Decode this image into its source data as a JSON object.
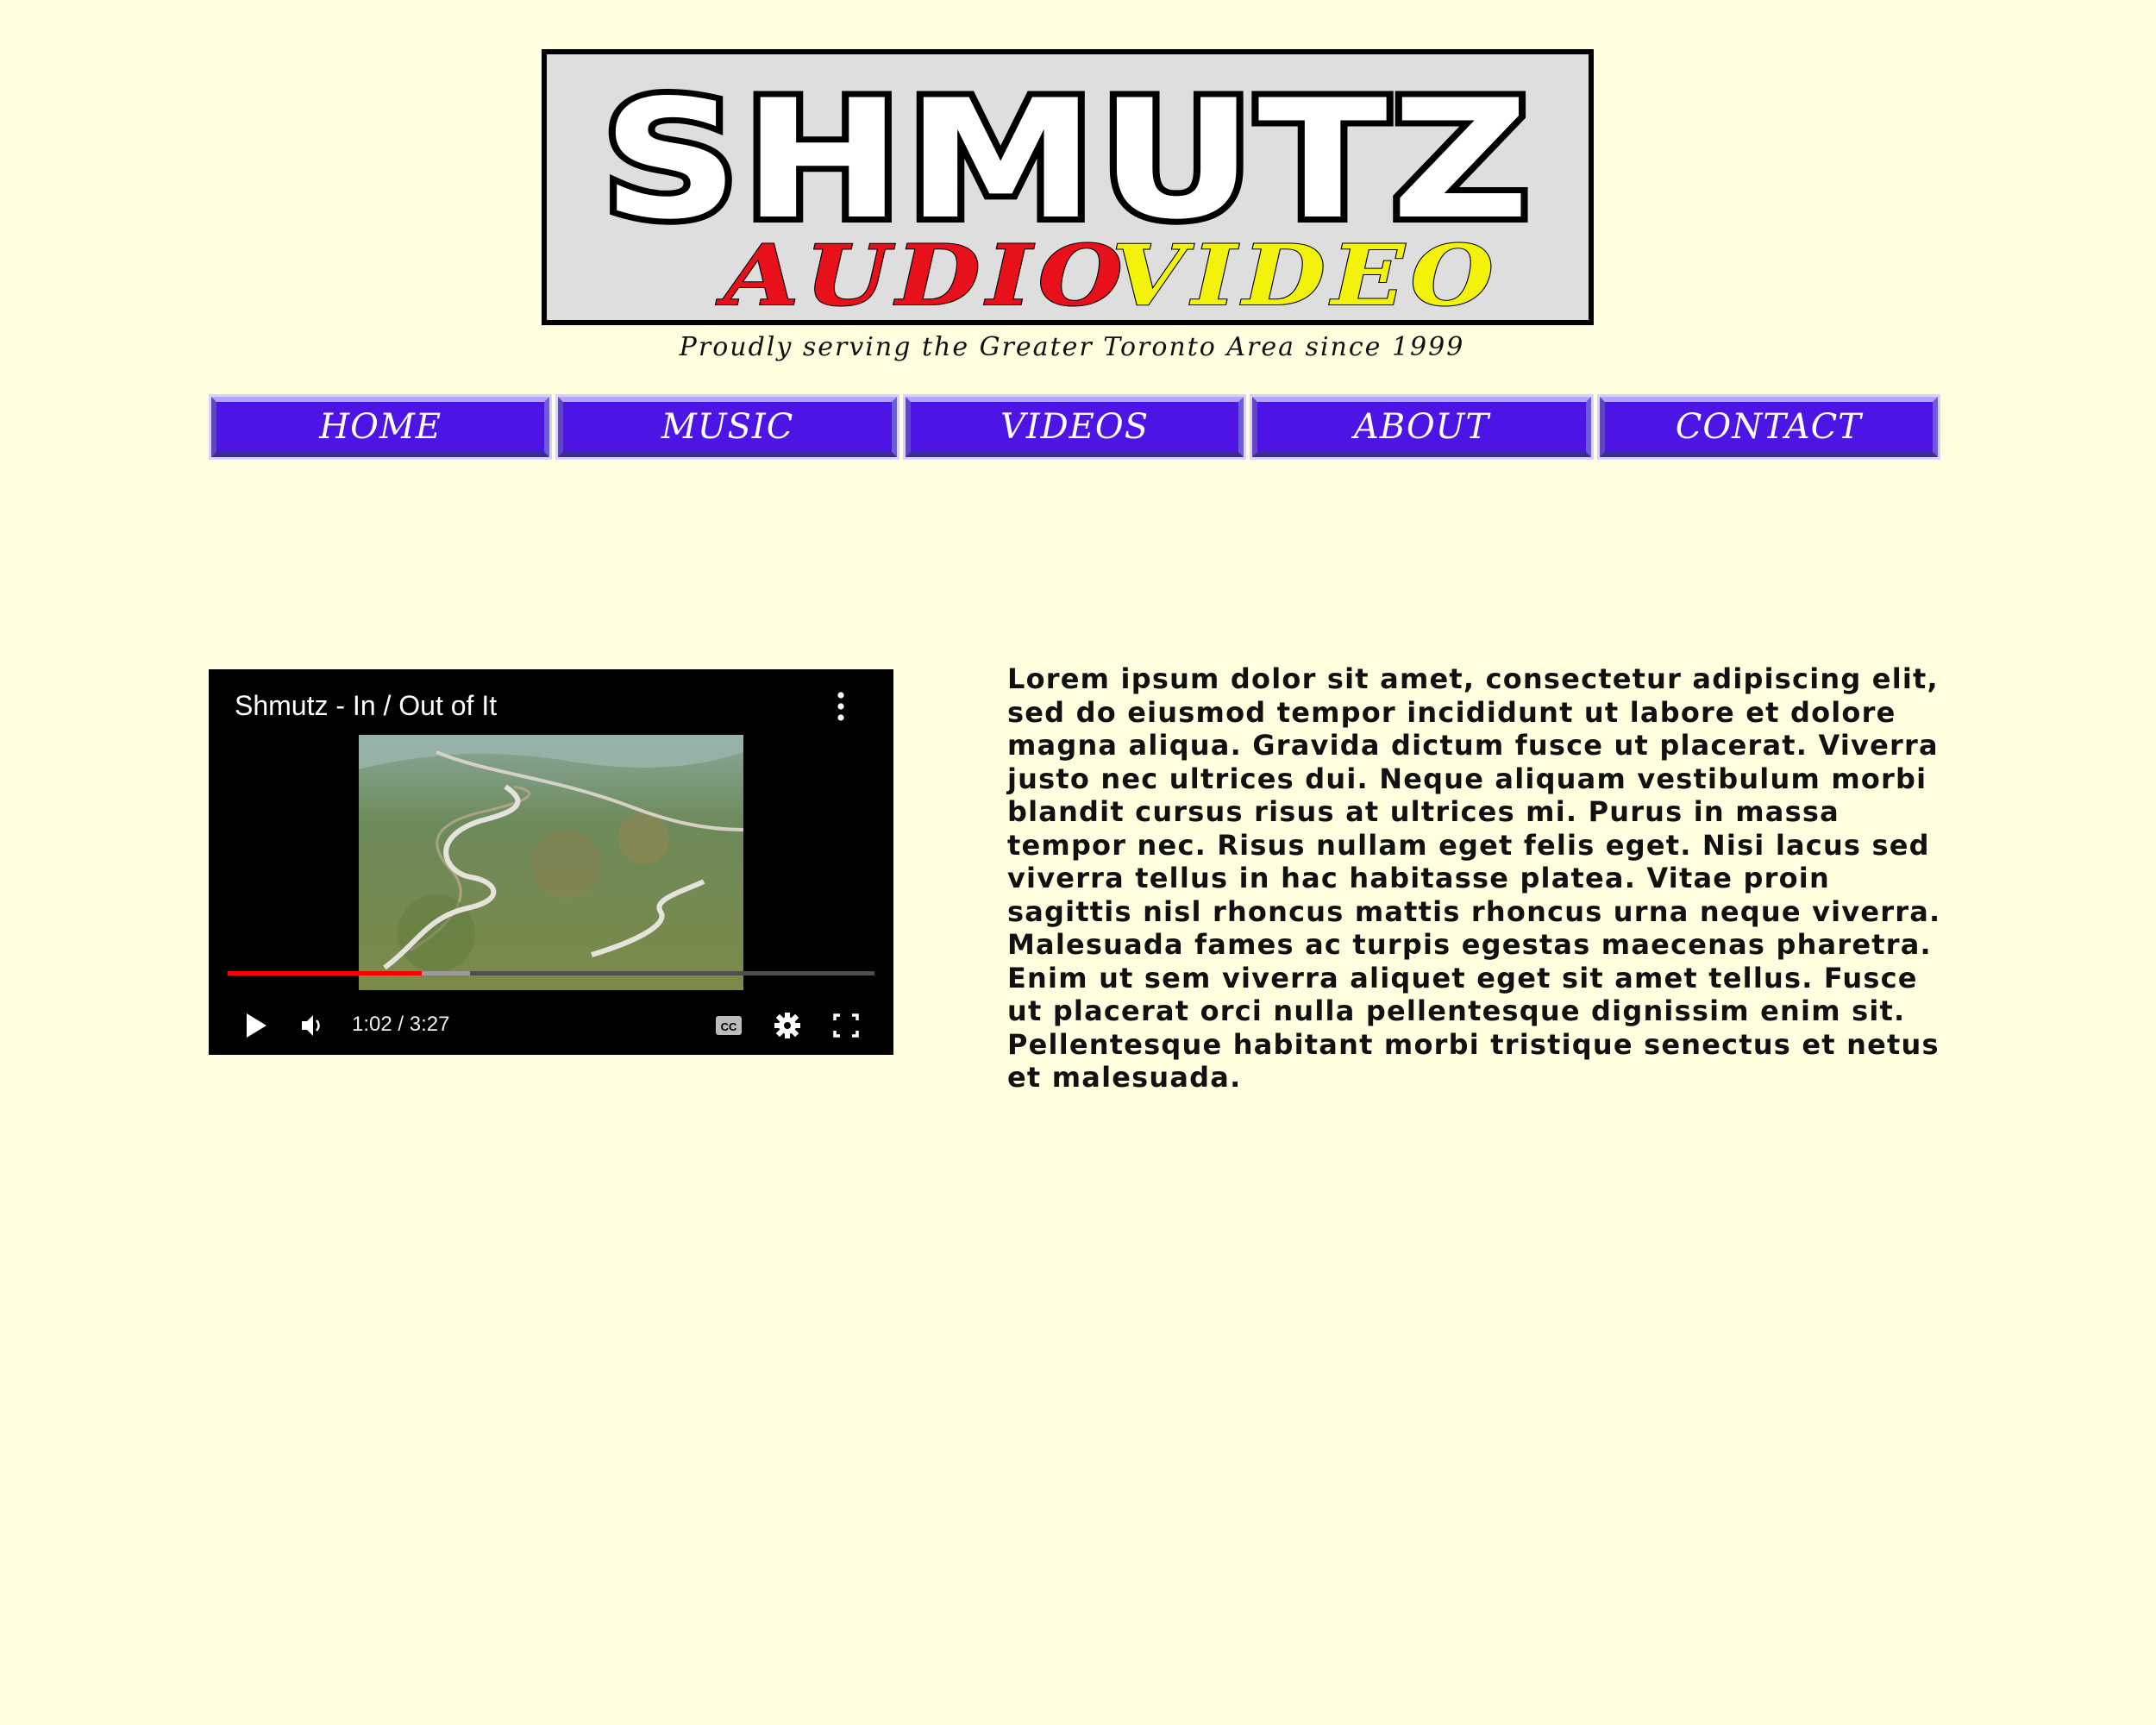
{
  "logo": {
    "main_text": "SHMUTZ",
    "audio_text": "AUDIO",
    "video_text": "VIDEO",
    "audio_color": "#e8101a",
    "video_color": "#f2f20a",
    "tagline": "Proudly serving the Greater Toronto Area since 1999"
  },
  "nav": {
    "items": [
      {
        "label": "HOME"
      },
      {
        "label": "MUSIC"
      },
      {
        "label": "VIDEOS"
      },
      {
        "label": "ABOUT"
      },
      {
        "label": "CONTACT"
      }
    ]
  },
  "video": {
    "title": "Shmutz - In / Out of It",
    "time": "1:02 / 3:27",
    "progress_played": 0.3,
    "progress_buffered": 0.375,
    "icons": [
      "more-vert-icon",
      "play-icon",
      "volume-icon",
      "captions-icon",
      "settings-icon",
      "fullscreen-icon"
    ]
  },
  "content": {
    "paragraph": "Lorem ipsum dolor sit amet, consectetur adipiscing elit, sed do eiusmod tempor incididunt ut labore et dolore magna aliqua. Gravida dictum fusce ut placerat. Viverra justo nec ultrices dui. Neque aliquam vestibulum morbi blandit cursus risus at ultrices mi. Purus in massa tempor nec. Risus nullam eget felis eget. Nisi lacus sed viverra tellus in hac habitasse platea. Vitae proin sagittis nisl rhoncus mattis rhoncus urna neque viverra. Malesuada fames ac turpis egestas maecenas pharetra. Enim ut sem viverra aliquet eget sit amet tellus. Fusce ut placerat orci nulla pellentesque dignissim enim sit. Pellentesque habitant morbi tristique senectus et netus et malesuada."
  },
  "colors": {
    "page_background": "#ffffdf",
    "nav_button": "#4d14e6",
    "progress_red": "#ff0000"
  }
}
